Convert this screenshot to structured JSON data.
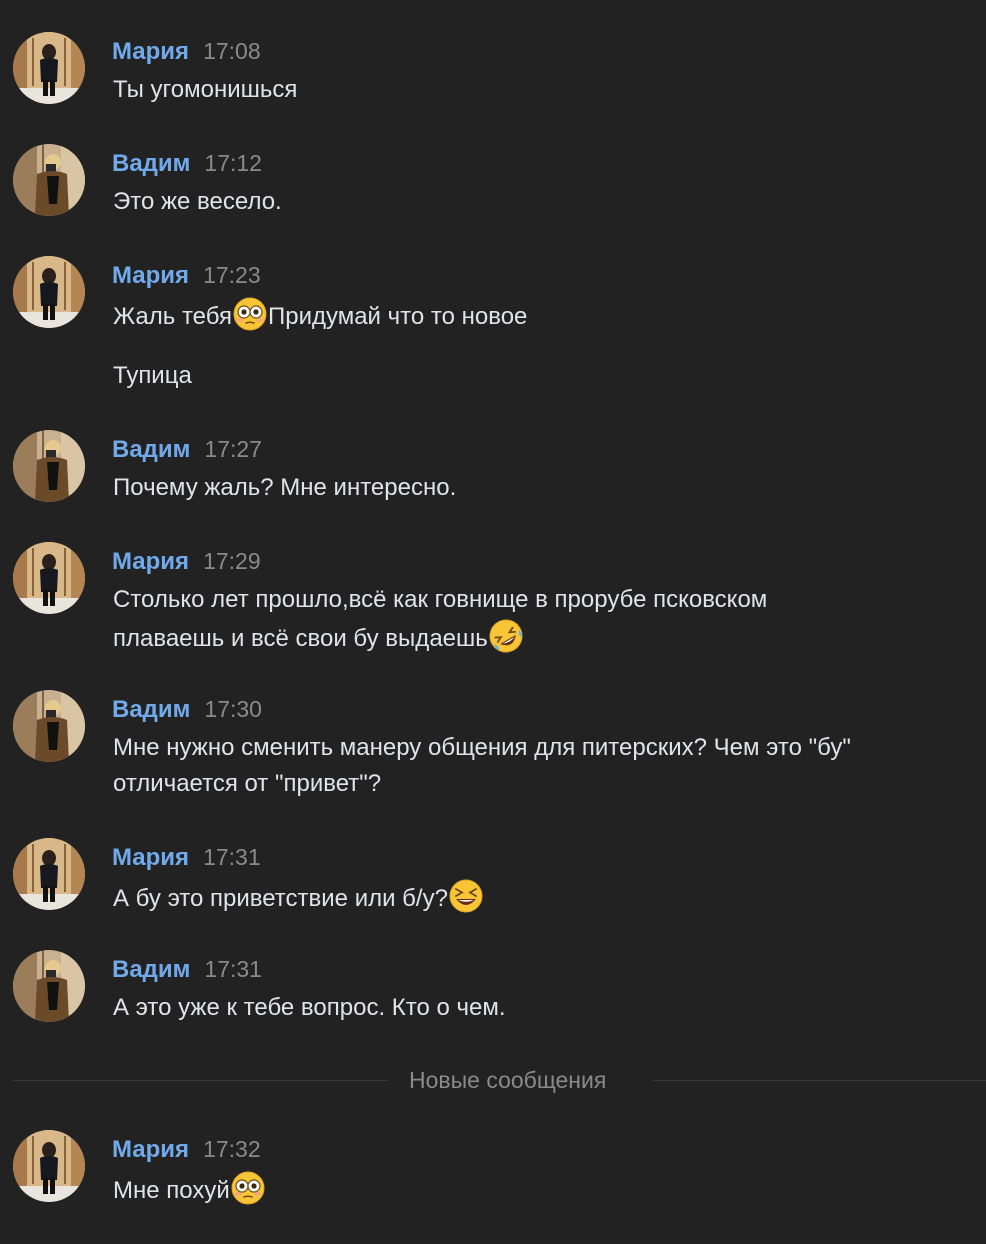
{
  "colors": {
    "background": "#222222",
    "author_name": "#71aaeb",
    "timestamp": "#8a8a8a",
    "message_text": "#e1e3e6",
    "divider": "#3a3a3a"
  },
  "messages": [
    {
      "author": "Мария",
      "time": "17:08",
      "avatar": "avatar-photo-maria",
      "lines": [
        {
          "parts": [
            {
              "text": "Ты угомонишься"
            }
          ]
        }
      ]
    },
    {
      "author": "Вадим",
      "time": "17:12",
      "avatar": "avatar-photo-vadim",
      "lines": [
        {
          "parts": [
            {
              "text": "Это же весело."
            }
          ]
        }
      ]
    },
    {
      "author": "Мария",
      "time": "17:23",
      "avatar": "avatar-photo-maria",
      "lines": [
        {
          "parts": [
            {
              "text": "Жаль тебя"
            },
            {
              "emoji": "flushed-face"
            },
            {
              "text": "Придумай что то новое"
            }
          ]
        },
        {
          "parts": [
            {
              "text": "Тупица"
            }
          ]
        }
      ]
    },
    {
      "author": "Вадим",
      "time": "17:27",
      "avatar": "avatar-photo-vadim",
      "lines": [
        {
          "parts": [
            {
              "text": "Почему жаль? Мне интересно."
            }
          ]
        }
      ]
    },
    {
      "author": "Мария",
      "time": "17:29",
      "avatar": "avatar-photo-maria",
      "lines": [
        {
          "parts": [
            {
              "text": "Столько лет прошло,всё как говнище в прорубе псковском плаваешь и всё свои бу выдаешь"
            },
            {
              "emoji": "rolling-on-floor-laughing-face"
            }
          ]
        }
      ]
    },
    {
      "author": "Вадим",
      "time": "17:30",
      "avatar": "avatar-photo-vadim",
      "lines": [
        {
          "parts": [
            {
              "text": "Мне нужно сменить манеру общения для питерских? Чем это \"бу\" отличается от \"привет\"?"
            }
          ]
        }
      ]
    },
    {
      "author": "Мария",
      "time": "17:31",
      "avatar": "avatar-photo-maria",
      "lines": [
        {
          "parts": [
            {
              "text": "А бу это приветствие или б/у?"
            },
            {
              "emoji": "grinning-squinting-face"
            }
          ]
        }
      ]
    },
    {
      "author": "Вадим",
      "time": "17:31",
      "avatar": "avatar-photo-vadim",
      "lines": [
        {
          "parts": [
            {
              "text": "А это уже к тебе вопрос. Кто о чем."
            }
          ]
        }
      ]
    },
    {
      "author": "Мария",
      "time": "17:32",
      "avatar": "avatar-photo-maria",
      "lines": [
        {
          "parts": [
            {
              "text": "Мне похуй"
            },
            {
              "emoji": "flushed-face"
            }
          ]
        }
      ]
    }
  ],
  "new_messages_divider": {
    "label": "Новые сообщения"
  }
}
